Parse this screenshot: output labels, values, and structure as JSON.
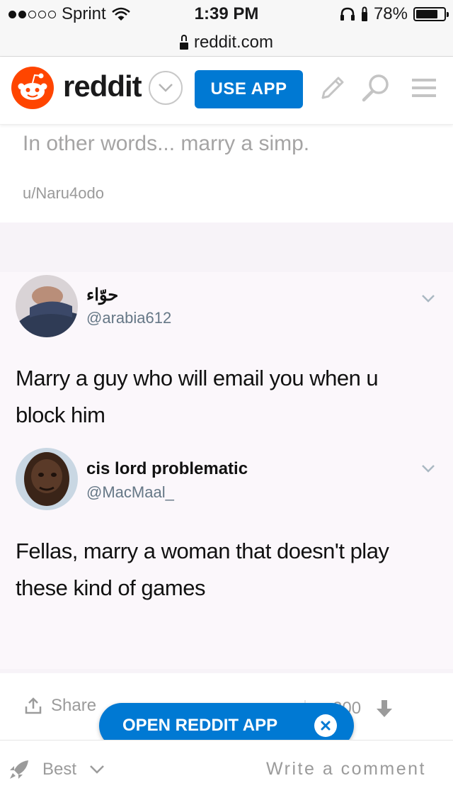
{
  "status_bar": {
    "carrier": "Sprint",
    "time": "1:39 PM",
    "battery": "78%",
    "battery_level": 0.78
  },
  "url_bar": {
    "url": "reddit.com"
  },
  "header": {
    "wordmark": "reddit",
    "use_app_label": "USE APP",
    "colors": {
      "brand": "#ff4500",
      "accent": "#0079d3"
    }
  },
  "post": {
    "title": "In other words... marry a simp.",
    "author": "u/Naru4odo"
  },
  "tweets": [
    {
      "name": "حوّاء",
      "handle": "@arabia612",
      "text_line1": "Marry a guy who will email you when u",
      "text_line2": "block him"
    },
    {
      "name": "cis lord problematic",
      "handle": "@MacMaal_",
      "text_line1": "Fellas, marry a woman that doesn't play",
      "text_line2": "these kind of games"
    }
  ],
  "actions": {
    "share_label": "Share",
    "score": "200"
  },
  "open_app": {
    "label": "OPEN REDDIT APP"
  },
  "bottom_bar": {
    "sort_label": "Best",
    "comment_placeholder": "Write a comment"
  }
}
